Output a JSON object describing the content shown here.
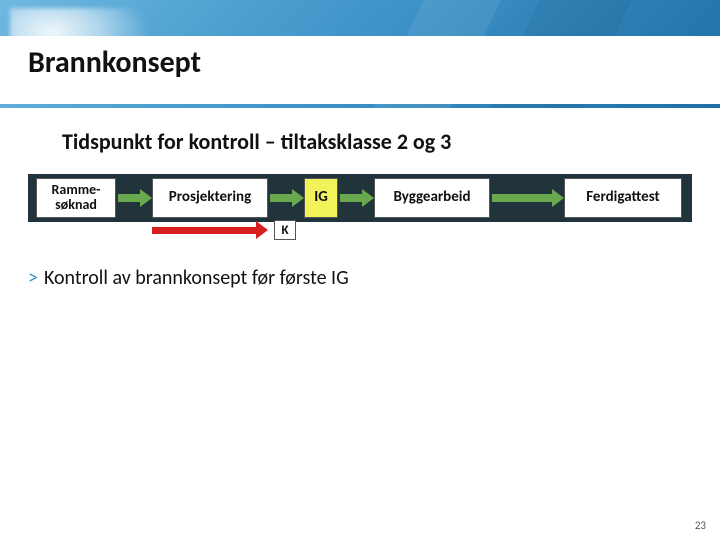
{
  "slide": {
    "title": "Brannkonsept",
    "subtitle": "Tidspunkt for kontroll – tiltaksklasse 2 og 3",
    "page_number": "23"
  },
  "flow": {
    "ramme": "Ramme-\nsøknad",
    "prosjektering": "Prosjektering",
    "ig": "IG",
    "byggearbeid": "Byggearbeid",
    "ferdigattest": "Ferdigattest",
    "k_label": "K"
  },
  "bullet": {
    "marker": ">",
    "text": "Kontroll av brannkonsept før første IG"
  }
}
